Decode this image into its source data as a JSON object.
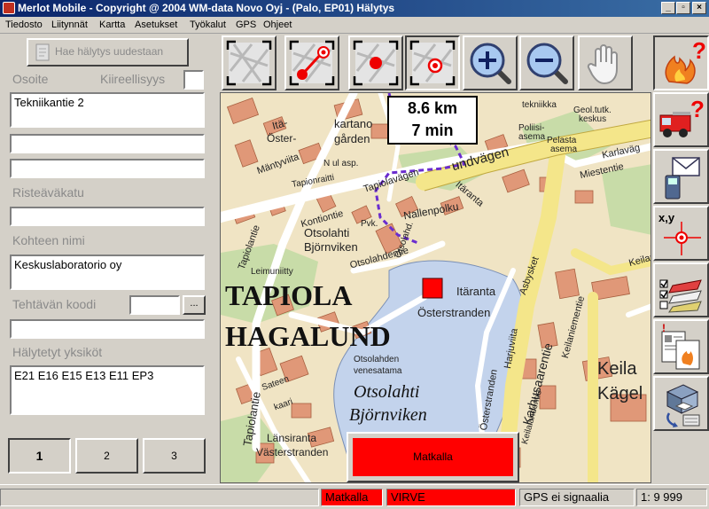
{
  "window": {
    "title": "Merlot Mobile - Copyright @ 2004 WM-data Novo Oyj - (Palo, EP01) Hälytys",
    "controls": [
      "_",
      "▫",
      "×"
    ]
  },
  "menu": [
    "Tiedosto",
    "Liitynnät",
    "Kartta",
    "Asetukset",
    "Työkalut",
    "GPS",
    "Ohjeet"
  ],
  "left_panel": {
    "fetch_button": "Hae hälytys uudestaan",
    "labels": {
      "address": "Osoite",
      "urgency": "Kiireellisyys",
      "cross_street": "Risteäväkatu",
      "target_name": "Kohteen nimi",
      "task_code": "Tehtävän koodi",
      "alerted_units": "Hälytetyt yksiköt"
    },
    "fields": {
      "urgency": "",
      "address_line1": "Tekniikantie  2",
      "address_line2": "",
      "address_line3": "",
      "cross_street": "",
      "target_name": "Keskuslaboratorio oy",
      "task_code": "",
      "task_desc": "",
      "alerted_units": "E21 E16 E15 E13 E11 EP3"
    },
    "browse_button": "...",
    "unit_buttons": [
      "1",
      "2",
      "3"
    ]
  },
  "map_toolbar": {
    "tools": [
      "map-overview",
      "route-to-target",
      "center-own-location",
      "center-target",
      "zoom-in",
      "zoom-out",
      "pan-hand"
    ]
  },
  "side_toolbar": {
    "tools": [
      "alarm-help",
      "vehicle-help",
      "messages",
      "coordinates",
      "checklist",
      "documents",
      "print"
    ],
    "coord_label": "x,y"
  },
  "map": {
    "distance": "8.6 km",
    "time": "7 min",
    "status_button": "Matkalla",
    "labels": {
      "ita_oster": "Itä-",
      "ita_oster2": "Öster-",
      "kartano": "kartano",
      "garden": "gården",
      "mantyviita": "Mäntyviita",
      "nulasp": "N ul asp.",
      "tapionraitti": "Tapionraitti",
      "tapiolavagen": "Tapiolavägen",
      "tundvagen": "undvägen",
      "itaranta_road": "Itäranta",
      "nallenpolku": "Nallenpolku",
      "kontiontie": "Kontiontie",
      "otsolahti1": "Otsolahti",
      "bjornviken1": "Björnviken",
      "tapiolantie": "Tapiolantie",
      "leimuniitty": "Leimuniitty",
      "otsolahdentie": "Otsolahdentie",
      "pvk": "Pvk.",
      "otsolahdenranta": "Otsolahd.",
      "tapiola": "TAPIOLA",
      "hagalund": "HAGALUND",
      "itaranta": "Itäranta",
      "osterstranden": "Österstranden",
      "asbysket": "Asbysket",
      "harjuviita": "Harjuviita",
      "ostranden": "Österstranden",
      "karhusaarentie": "Karhusaarentie",
      "keilaranta": "Keilaranta",
      "keilaniementie": "Keilaniementie",
      "keila": "Keila",
      "kagel": "Kägel",
      "otsolahden_venesatama": "Otsolahden",
      "venesatama": "venesatama",
      "otsolahti2": "Otsolahti",
      "bjornviken2": "Björnviken",
      "lansiranta": "Länsiranta",
      "vasterstranden": "Västerstranden",
      "sateenkaari": "Sateen",
      "kaari": "kaari",
      "tapiolantie2": "Tapiolantie",
      "keilalahdentie": "Keilalahdentie",
      "keilaniemi": "Keilani",
      "miestentie": "Miestentie",
      "karlavag": "Karlaväg",
      "geol_tutk": "Geol.tutk.",
      "keskus": "keskus",
      "poliisi": "Poliisi-",
      "asema": "asema",
      "pelasta": "Pelasta",
      "asema2": "asema",
      "tekniikka": "tekniikka",
      "kelloranta": "Kelloran",
      "itaranta2": "Itärantä",
      "otsolahti_small": "Otsolahti",
      "kalastajantie": "Kalastajantie",
      "entie": "entie",
      "tapiolantie3": "Tapiolantie",
      "keilaranta2": "Keilaranta"
    }
  },
  "status_bar": {
    "status": "Matkalla",
    "virve": "VIRVE",
    "gps": "GPS ei signaalia",
    "scale": "1: 9 999"
  },
  "colors": {
    "status_red": "#ff0000",
    "titlebar_blue": "#0a246a",
    "route_purple": "#6a2ccf",
    "water": "#c3d3ec"
  }
}
